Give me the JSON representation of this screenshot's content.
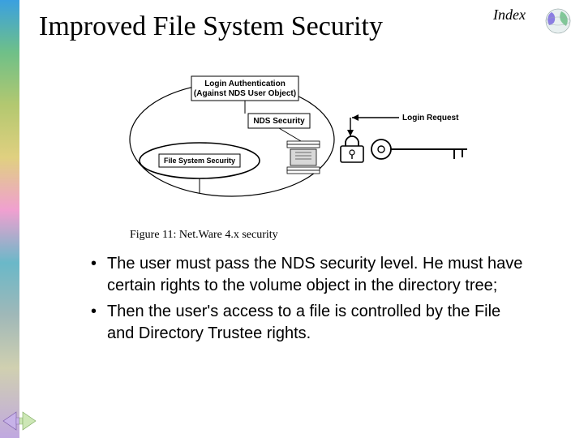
{
  "header": {
    "title": "Improved File System Security",
    "index_link": "Index"
  },
  "diagram": {
    "label_login_auth_line1": "Login Authentication",
    "label_login_auth_line2": "(Against NDS User Object)",
    "label_nds_security": "NDS Security",
    "label_fs_security": "File System Security",
    "label_login_request": "Login Request"
  },
  "figure": {
    "caption": "Figure 11: Net.Ware 4.x security"
  },
  "bullets": {
    "item1": "The user must pass the NDS security level. He must have certain rights to the volume object in the directory tree;",
    "item2": "Then the user's access to a file is controlled by the File and Directory Trustee rights."
  }
}
